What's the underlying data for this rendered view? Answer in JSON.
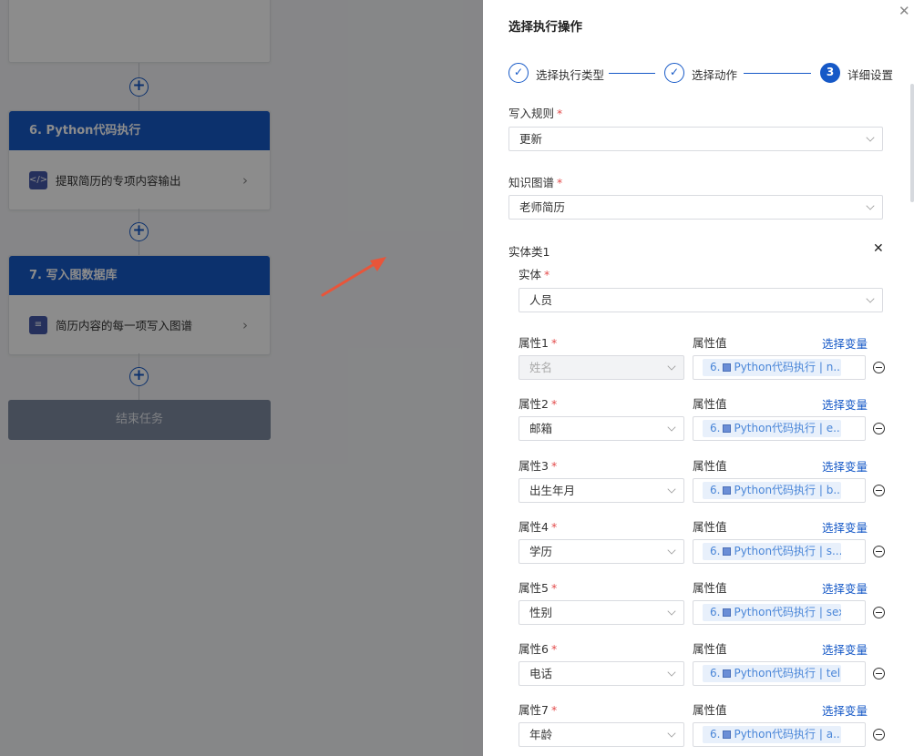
{
  "canvas": {
    "nodes": [
      {
        "title": "6. Python代码执行",
        "desc": "提取简历的专项内容输出",
        "icon": "code-icon"
      },
      {
        "title": "7. 写入图数据库",
        "desc": "简历内容的每一项写入图谱",
        "icon": "database-icon"
      }
    ],
    "end_label": "结束任务"
  },
  "drawer": {
    "title": "选择执行操作",
    "steps": [
      {
        "label": "选择执行类型",
        "status": "done",
        "mark": "✓"
      },
      {
        "label": "选择动作",
        "status": "done",
        "mark": "✓"
      },
      {
        "label": "详细设置",
        "status": "active",
        "mark": "3"
      }
    ],
    "write_rule": {
      "label": "写入规则",
      "value": "更新"
    },
    "kg": {
      "label": "知识图谱",
      "value": "老师简历"
    },
    "entity_class": {
      "label": "实体类1",
      "entity": {
        "label": "实体",
        "value": "人员"
      },
      "attr_value_label": "属性值",
      "select_var_label": "选择变量",
      "attributes": [
        {
          "label": "属性1",
          "value": "姓名",
          "disabled": true,
          "tag_prefix": "6.",
          "tag": "Python代码执行 | n..."
        },
        {
          "label": "属性2",
          "value": "邮箱",
          "disabled": false,
          "tag_prefix": "6.",
          "tag": "Python代码执行 | e..."
        },
        {
          "label": "属性3",
          "value": "出生年月",
          "disabled": false,
          "tag_prefix": "6.",
          "tag": "Python代码执行 | b..."
        },
        {
          "label": "属性4",
          "value": "学历",
          "disabled": false,
          "tag_prefix": "6.",
          "tag": "Python代码执行 | s..."
        },
        {
          "label": "属性5",
          "value": "性别",
          "disabled": false,
          "tag_prefix": "6.",
          "tag": "Python代码执行 | sex"
        },
        {
          "label": "属性6",
          "value": "电话",
          "disabled": false,
          "tag_prefix": "6.",
          "tag": "Python代码执行 | tel"
        },
        {
          "label": "属性7",
          "value": "年龄",
          "disabled": false,
          "tag_prefix": "6.",
          "tag": "Python代码执行 | a..."
        }
      ]
    }
  },
  "colors": {
    "primary": "#1659c7",
    "tag_bg": "#e8f0fb",
    "tag_text": "#4a86d8",
    "annotation_arrow": "#e8553a"
  }
}
